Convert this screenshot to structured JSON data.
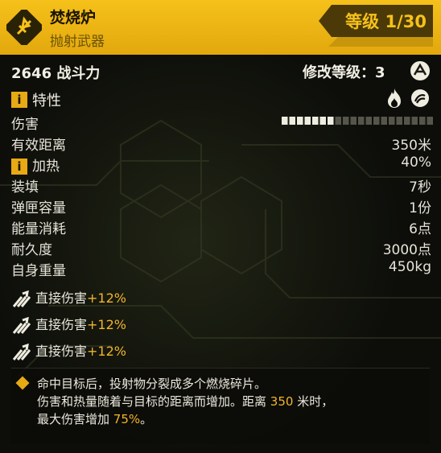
{
  "header": {
    "title": "焚烧炉",
    "subtitle": "抛射武器",
    "level_label": "等级 1/30",
    "icon": "incinerator-weapon-icon"
  },
  "summary": {
    "power": "2646 战斗力",
    "mod_level_label": "修改等级：3",
    "mod_icon": "mod-badge-icon"
  },
  "traits": {
    "badge": "i",
    "label": "特性",
    "icons": [
      "fire-icon",
      "burst-icon"
    ]
  },
  "stats": [
    {
      "label": "伤害",
      "value": ""
    },
    {
      "label": "有效距离",
      "value": "350米"
    },
    {
      "label": "加热",
      "value": "40%",
      "badge": "i"
    },
    {
      "label": "装填",
      "value": "7秒"
    },
    {
      "label": "弹匣容量",
      "value": "1份"
    },
    {
      "label": "能量消耗",
      "value": "6点"
    },
    {
      "label": "耐久度",
      "value": "3000点"
    },
    {
      "label": "自身重量",
      "value": "450kg"
    }
  ],
  "damage_bar": {
    "filled_fraction": 0.34
  },
  "mods": [
    {
      "label": "直接伤害",
      "bonus": "+12%"
    },
    {
      "label": "直接伤害",
      "bonus": "+12%"
    },
    {
      "label": "直接伤害",
      "bonus": "+12%"
    }
  ],
  "description": {
    "line1": "命中目标后，投射物分裂成多个燃烧碎片。",
    "line2_pre": "伤害和热量随着与目标的距离而增加。距离",
    "line2_hl": "350",
    "line2_post": "米时，",
    "line3_pre": "最大伤害增加",
    "line3_hl": "75%",
    "line3_post": "。"
  },
  "colors": {
    "accent": "#f6c11a",
    "highlight": "#f2b52b",
    "panel": "#0d0e0a"
  }
}
